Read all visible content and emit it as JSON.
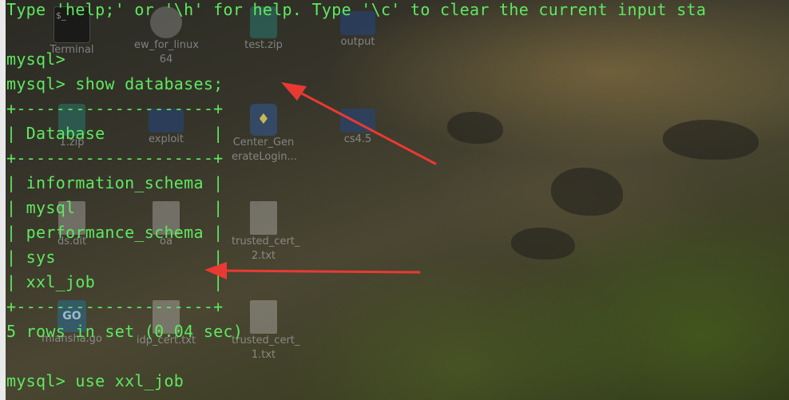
{
  "terminal": {
    "lines": [
      "Type 'help;' or '\\h' for help. Type '\\c' to clear the current input sta",
      "",
      "mysql>",
      "mysql> show databases;",
      "+--------------------+",
      "| Database           |",
      "+--------------------+",
      "| information_schema |",
      "| mysql              |",
      "| performance_schema |",
      "| sys                |",
      "| xxl_job            |",
      "+--------------------+",
      "5 rows in set (0.04 sec)",
      "",
      "mysql> use xxl_job"
    ],
    "text_color": "#5fe85f"
  },
  "desktop_icons": [
    {
      "label": "Terminal",
      "icon": "terminal-icon"
    },
    {
      "label": "ew_for_linux 64",
      "icon": "gear-icon"
    },
    {
      "label": "test.zip",
      "icon": "zip-icon"
    },
    {
      "label": "output",
      "icon": "folder-icon"
    },
    {
      "label": "1.zip",
      "icon": "zip-icon"
    },
    {
      "label": "exploit",
      "icon": "folder-icon"
    },
    {
      "label": "Center_Gen erateLogin...",
      "icon": "python-icon"
    },
    {
      "label": "cs4.5",
      "icon": "folder-icon"
    },
    {
      "label": "ds.dit",
      "icon": "document-icon"
    },
    {
      "label": "oa",
      "icon": "document-icon"
    },
    {
      "label": "trusted_cert_ 2.txt",
      "icon": "document-icon"
    },
    {
      "label": "miansha.go",
      "icon": "go-icon"
    },
    {
      "label": "idp_cert.txt",
      "icon": "document-icon"
    },
    {
      "label": "trusted_cert_ 1.txt",
      "icon": "document-icon"
    }
  ],
  "annotations": {
    "arrow_color": "#e83a32"
  }
}
